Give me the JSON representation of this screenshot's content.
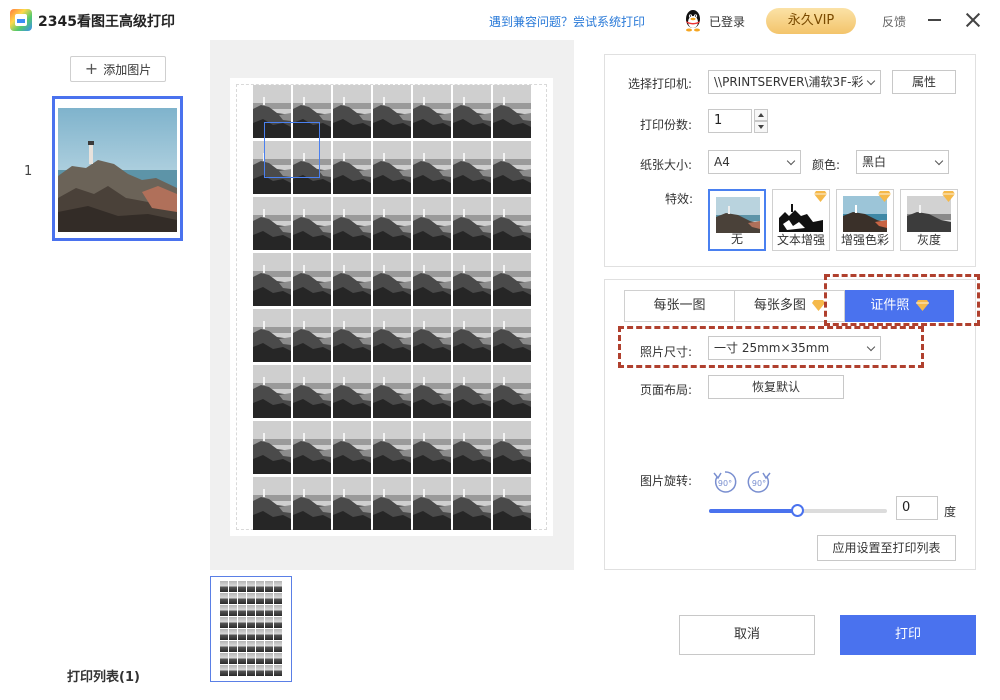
{
  "window": {
    "title": "2345看图王高级打印",
    "compat_link": "遇到兼容问题？尝试系统打印",
    "login_status": "已登录",
    "vip_label": "永久VIP",
    "feedback_label": "反馈"
  },
  "left_panel": {
    "add_image_label": "添加图片",
    "image_index": "1",
    "print_list_label": "打印列表(1)"
  },
  "settings": {
    "printer_label": "选择打印机:",
    "printer_value": "\\\\PRINTSERVER\\浦软3F-彩",
    "properties_label": "属性",
    "copies_label": "打印份数:",
    "copies_value": "1",
    "paper_size_label": "纸张大小:",
    "paper_size_value": "A4",
    "color_label": "颜色:",
    "color_value": "黑白",
    "effects_label": "特效:",
    "effects": [
      {
        "label": "无",
        "selected": true,
        "premium": false
      },
      {
        "label": "文本增强",
        "selected": false,
        "premium": true
      },
      {
        "label": "增强色彩",
        "selected": false,
        "premium": true
      },
      {
        "label": "灰度",
        "selected": false,
        "premium": true
      }
    ]
  },
  "photo_settings": {
    "tabs": [
      {
        "label": "每张一图",
        "active": false,
        "premium": false
      },
      {
        "label": "每张多图",
        "active": false,
        "premium": true
      },
      {
        "label": "证件照",
        "active": true,
        "premium": true
      }
    ],
    "photo_size_label": "照片尺寸:",
    "photo_size_value": "一寸 25mm×35mm",
    "layout_label": "页面布局:",
    "restore_default_label": "恢复默认",
    "rotation_label": "图片旋转:",
    "rotate_left_label": "90°",
    "rotate_right_label": "90°",
    "rotation_value": "0",
    "rotation_unit": "度",
    "rotation_slider_fraction": 0.5,
    "apply_to_list_label": "应用设置至打印列表"
  },
  "actions": {
    "cancel_label": "取消",
    "print_label": "打印"
  },
  "preview": {
    "grid_cols": 7,
    "grid_rows": 8
  },
  "colors": {
    "accent": "#4a72ee",
    "highlight_dash": "#b0402e",
    "vip_gold": "#f3c46b",
    "premium_diamond": "#f5b94a"
  }
}
